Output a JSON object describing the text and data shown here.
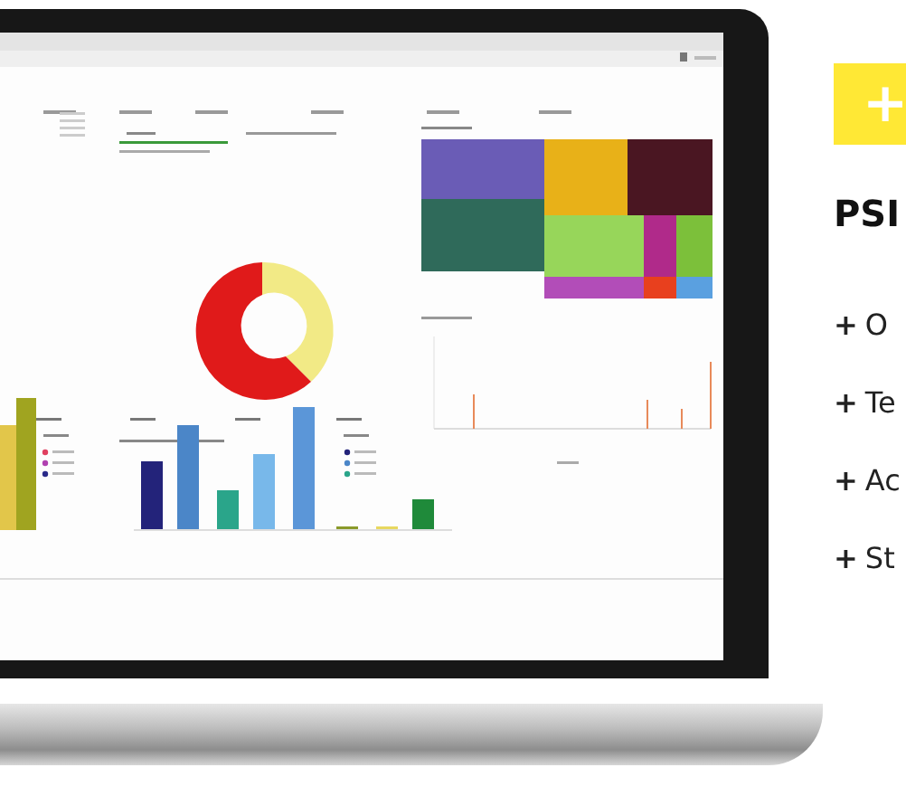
{
  "cta_button": {
    "label": "+"
  },
  "heading": "PSI",
  "features": [
    {
      "bullet": "+",
      "text": "O"
    },
    {
      "bullet": "+",
      "text": "Te"
    },
    {
      "bullet": "+",
      "text": "Ac"
    },
    {
      "bullet": "+",
      "text": "St"
    }
  ]
}
